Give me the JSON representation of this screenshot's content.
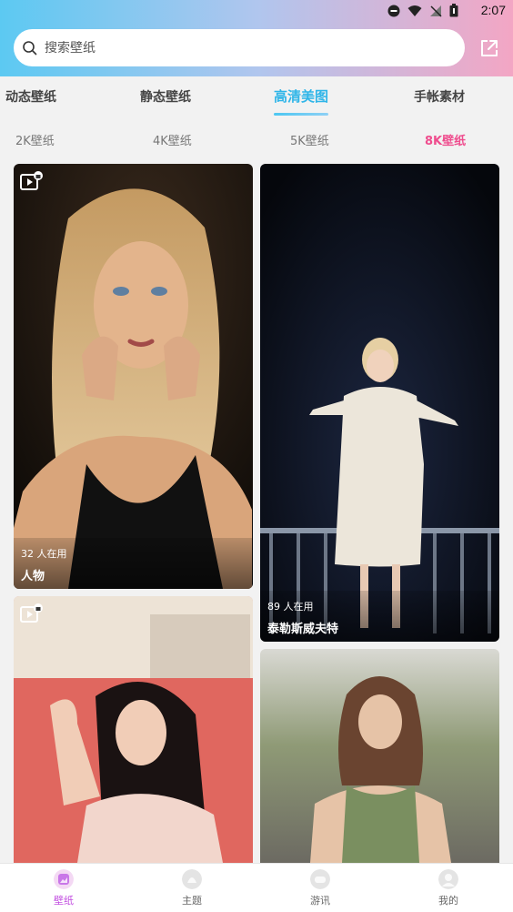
{
  "status_bar": {
    "time": "2:07"
  },
  "search": {
    "placeholder": "搜索壁纸"
  },
  "tabs": [
    {
      "label": "动态壁纸",
      "active": false
    },
    {
      "label": "静态壁纸",
      "active": false
    },
    {
      "label": "高清美图",
      "active": true
    },
    {
      "label": "手帐素材",
      "active": false
    }
  ],
  "subtabs": [
    {
      "label": "2K壁纸",
      "active": false
    },
    {
      "label": "4K壁纸",
      "active": false
    },
    {
      "label": "5K壁纸",
      "active": false
    },
    {
      "label": "8K壁纸",
      "active": true
    }
  ],
  "cards": [
    {
      "users": "32 人在用",
      "title": "人物",
      "video": true
    },
    {
      "users": "89 人在用",
      "title": "泰勒斯威夫特",
      "video": false
    },
    {
      "users": "",
      "title": "",
      "video": true
    },
    {
      "users": "",
      "title": "",
      "video": false
    }
  ],
  "bottom_nav": [
    {
      "label": "壁纸",
      "active": true
    },
    {
      "label": "主题",
      "active": false
    },
    {
      "label": "游讯",
      "active": false
    },
    {
      "label": "我的",
      "active": false
    }
  ],
  "colors": {
    "active_tab": "#2fb5e8",
    "active_subtab": "#ef4d8e",
    "active_nav": "#c24ee0"
  }
}
